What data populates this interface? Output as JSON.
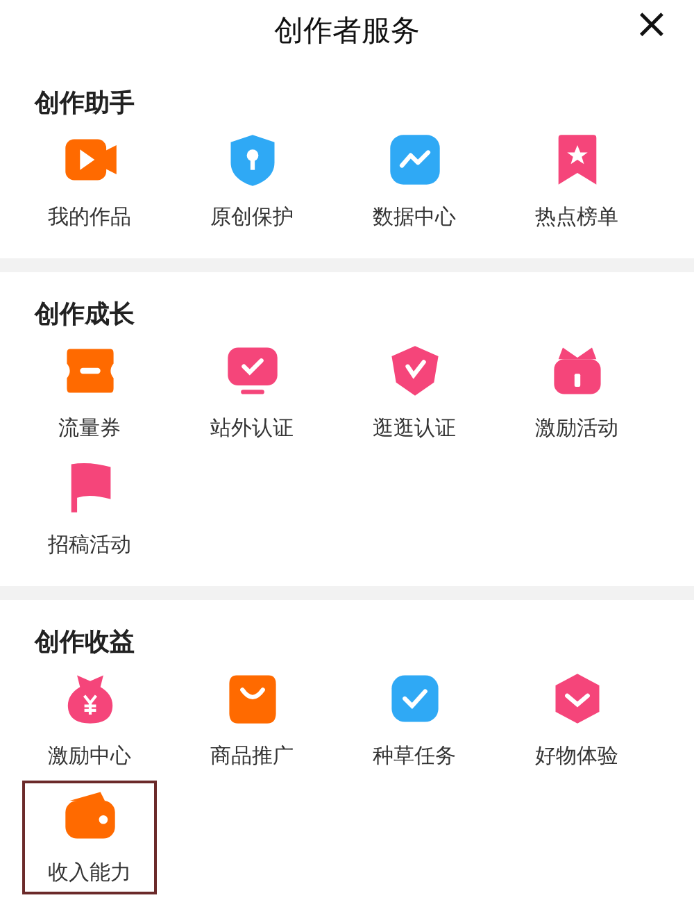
{
  "header": {
    "title": "创作者服务",
    "close": "×"
  },
  "sections": [
    {
      "title": "创作助手",
      "items": [
        {
          "label": "我的作品",
          "kind": "video",
          "color": "#ff6a00",
          "highlighted": false
        },
        {
          "label": "原创保护",
          "kind": "shield",
          "color": "#2fa9f5",
          "highlighted": false
        },
        {
          "label": "数据中心",
          "kind": "chart",
          "color": "#2fa9f5",
          "highlighted": false
        },
        {
          "label": "热点榜单",
          "kind": "bookmark",
          "color": "#f5457a",
          "highlighted": false
        }
      ]
    },
    {
      "title": "创作成长",
      "items": [
        {
          "label": "流量券",
          "kind": "ticket",
          "color": "#ff6a00",
          "highlighted": false
        },
        {
          "label": "站外认证",
          "kind": "monitor",
          "color": "#f5457a",
          "highlighted": false
        },
        {
          "label": "逛逛认证",
          "kind": "badge",
          "color": "#f5457a",
          "highlighted": false
        },
        {
          "label": "激励活动",
          "kind": "gift",
          "color": "#f5457a",
          "highlighted": false
        },
        {
          "label": "招稿活动",
          "kind": "flag",
          "color": "#f5457a",
          "highlighted": false
        }
      ]
    },
    {
      "title": "创作收益",
      "items": [
        {
          "label": "激励中心",
          "kind": "moneybag",
          "color": "#f5457a",
          "highlighted": false
        },
        {
          "label": "商品推广",
          "kind": "bag",
          "color": "#ff6a00",
          "highlighted": false
        },
        {
          "label": "种草任务",
          "kind": "check",
          "color": "#2fa9f5",
          "highlighted": false
        },
        {
          "label": "好物体验",
          "kind": "hexagon",
          "color": "#f5457a",
          "highlighted": false
        },
        {
          "label": "收入能力",
          "kind": "wallet",
          "color": "#ff6a00",
          "highlighted": true
        }
      ]
    }
  ]
}
